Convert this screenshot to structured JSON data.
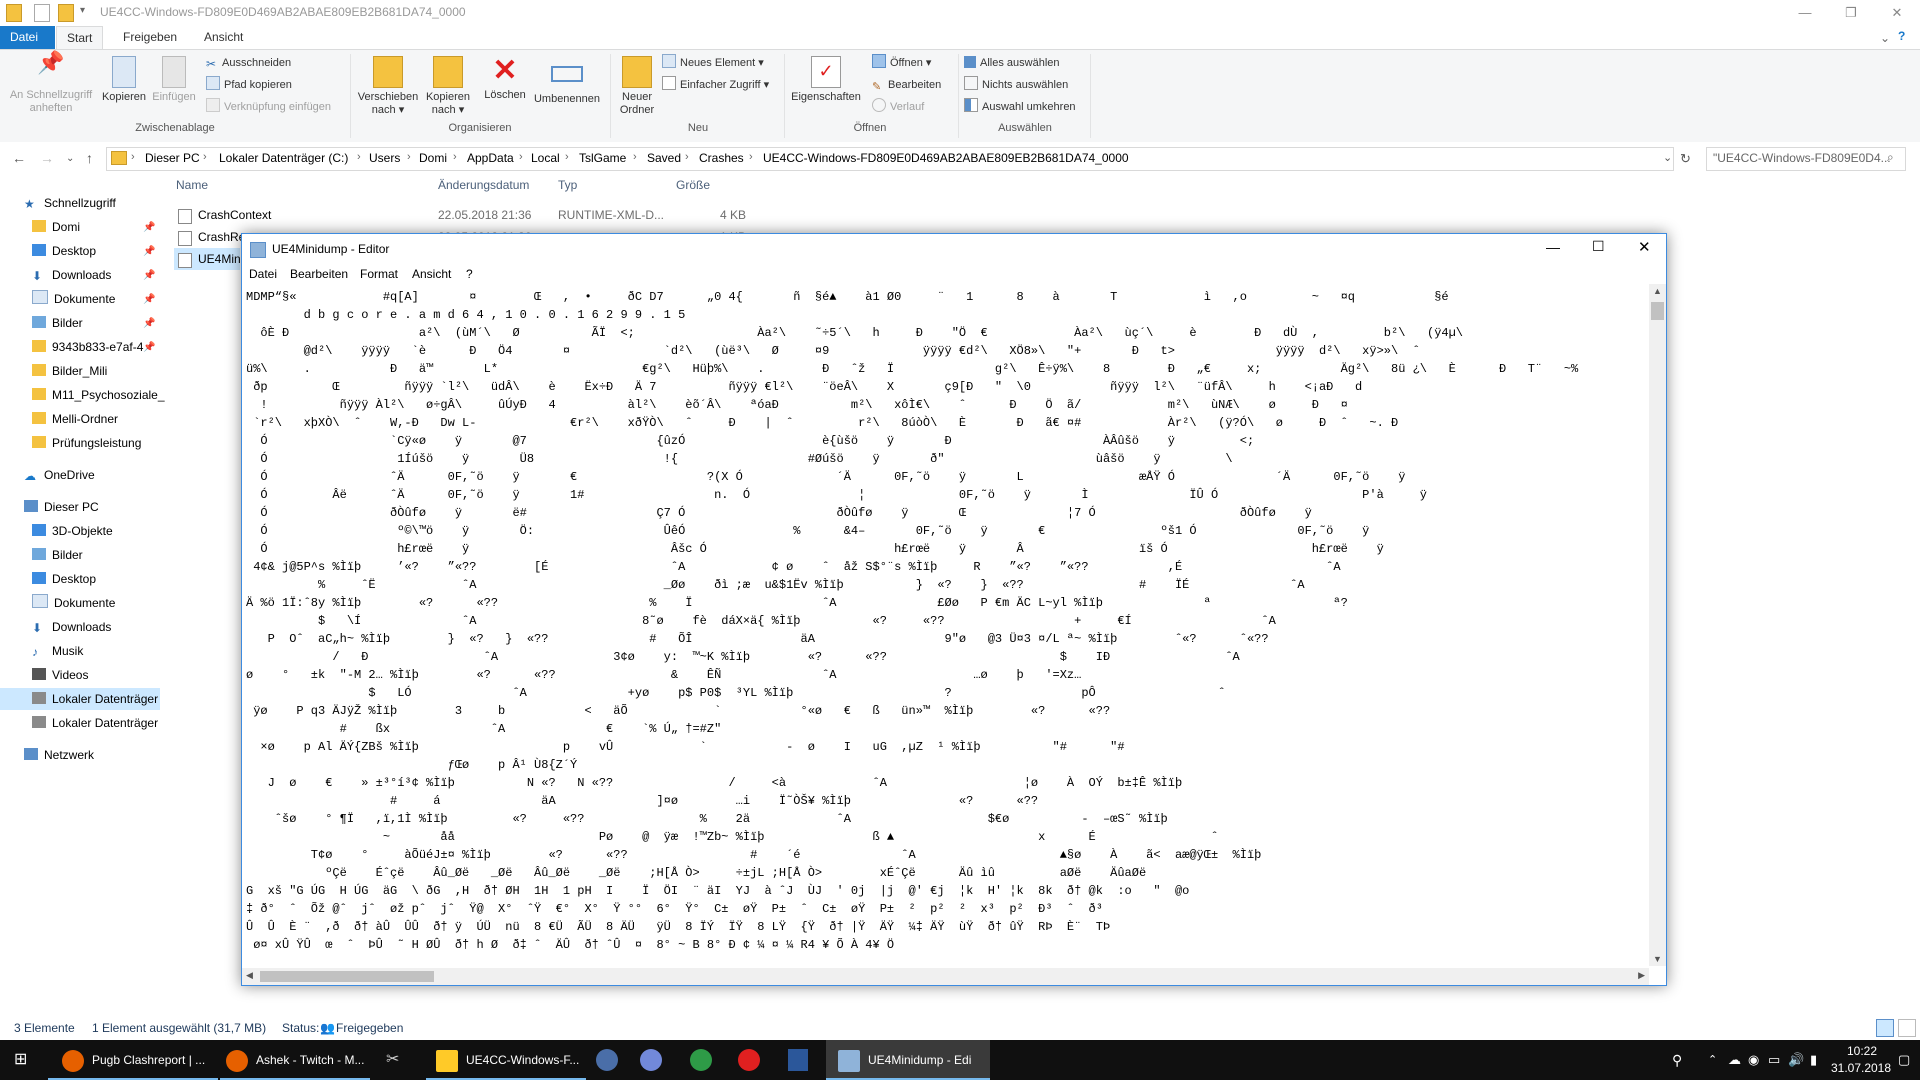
{
  "explorer": {
    "title": "UE4CC-Windows-FD809E0D469AB2ABAE809EB2B681DA74_0000",
    "tabs": [
      "Datei",
      "Start",
      "Freigeben",
      "Ansicht"
    ],
    "ribbon": {
      "clipboard": {
        "pin": "An Schnellzugriff anheften",
        "copy": "Kopieren",
        "paste": "Einfügen",
        "cut": "Ausschneiden",
        "copy_path": "Pfad kopieren",
        "paste_link": "Verknüpfung einfügen",
        "label": "Zwischenablage"
      },
      "organize": {
        "move": "Verschieben nach",
        "copy_to": "Kopieren nach",
        "delete": "Löschen",
        "rename": "Umbenennen",
        "label": "Organisieren"
      },
      "new": {
        "new_folder": "Neuer Ordner",
        "new_item": "Neues Element",
        "easy_access": "Einfacher Zugriff",
        "label": "Neu"
      },
      "open": {
        "properties": "Eigenschaften",
        "open": "Öffnen",
        "edit": "Bearbeiten",
        "history": "Verlauf",
        "label": "Öffnen"
      },
      "select": {
        "select_all": "Alles auswählen",
        "select_none": "Nichts auswählen",
        "invert": "Auswahl umkehren",
        "label": "Auswählen"
      }
    },
    "breadcrumb": [
      "Dieser PC",
      "Lokaler Datenträger (C:)",
      "Users",
      "Domi",
      "AppData",
      "Local",
      "TslGame",
      "Saved",
      "Crashes",
      "UE4CC-Windows-FD809E0D469AB2ABAE809EB2B681DA74_0000"
    ],
    "search_placeholder": "\"UE4CC-Windows-FD809E0D4...",
    "nav_pane": [
      {
        "label": "Schnellzugriff",
        "pinned": false
      },
      {
        "label": "Domi",
        "pinned": true
      },
      {
        "label": "Desktop",
        "pinned": true
      },
      {
        "label": "Downloads",
        "pinned": true
      },
      {
        "label": "Dokumente",
        "pinned": true
      },
      {
        "label": "Bilder",
        "pinned": true
      },
      {
        "label": "9343b833-e7af-4",
        "pinned": true
      },
      {
        "label": "Bilder_Mili",
        "pinned": false
      },
      {
        "label": "M11_Psychosoziale_",
        "pinned": false
      },
      {
        "label": "Melli-Ordner",
        "pinned": false
      },
      {
        "label": "Prüfungsleistung",
        "pinned": false
      },
      {
        "label": "OneDrive",
        "pinned": false
      },
      {
        "label": "Dieser PC",
        "pinned": false
      },
      {
        "label": "3D-Objekte",
        "pinned": false
      },
      {
        "label": "Bilder",
        "pinned": false
      },
      {
        "label": "Desktop",
        "pinned": false
      },
      {
        "label": "Dokumente",
        "pinned": false
      },
      {
        "label": "Downloads",
        "pinned": false
      },
      {
        "label": "Musik",
        "pinned": false
      },
      {
        "label": "Videos",
        "pinned": false
      },
      {
        "label": "Lokaler Datenträger",
        "pinned": false
      },
      {
        "label": "Lokaler Datenträger",
        "pinned": false
      },
      {
        "label": "Netzwerk",
        "pinned": false
      }
    ],
    "columns": [
      "Name",
      "Änderungsdatum",
      "Typ",
      "Größe"
    ],
    "files": [
      {
        "name": "CrashContext",
        "date": "22.05.2018 21:36",
        "type": "RUNTIME-XML-D...",
        "size": "4 KB"
      },
      {
        "name": "CrashRe",
        "date": "22.05.2018 21:36",
        "type": "",
        "size": "1 KB"
      },
      {
        "name": "UE4Mini",
        "date": "",
        "type": "",
        "size": ""
      }
    ],
    "status": {
      "count": "3 Elemente",
      "selected": "1 Element ausgewählt (31,7 MB)",
      "share": "Status:",
      "share_value": "Freigegeben"
    }
  },
  "notepad": {
    "title": "UE4Minidump - Editor",
    "menu": [
      "Datei",
      "Bearbeiten",
      "Format",
      "Ansicht",
      "?"
    ],
    "lines": [
      "MDMP“§«            #q[A]       ¤        Œ   ,  •     ðC D7      „0 4{       ñ  §é▲    à1 Ø0     ¨   1      8    à       T            ì   ,o         ~   ¤q           §é",
      "        d b g c o r e . a m d 6 4 , 1 0 . 0 . 1 6 2 9 9 . 1 5",
      "  ôÈ Ð                  a²\\  (ùM´\\   Ø          ÃÏ  <;                 Àa²\\    ˜÷5´\\   h     Ð    \"Ö  €            Àa²\\   ùç´\\     è        Ð   dÙ  ,         b²\\   (ÿ4µ\\",
      "        @d²\\    ÿÿÿÿ   `è      Ð   Ö4       ¤             `d²\\   (ùë³\\   Ø     ¤9             ÿÿÿÿ €d²\\   XÖ8»\\   \"+       Ð   t>              ÿÿÿÿ  d²\\   xÿ>»\\  ˆ",
      "ü%\\     .           Ð   ä™       L*                    €g²\\   Hüþ%\\    .        Ð   ˆž   Ï              g²\\   Ê÷ÿ%\\    8        Ð   „€     x;           Äg²\\   8ü ¿\\   È      Ð   T¨   ~%",
      " ðp         Œ         ñÿÿÿ `l²\\   üdÂ\\    è    Ëx÷Ð   Ä 7          ñÿÿÿ €l²\\    ¨öeÂ\\    X       ç9[Ð   \"  \\0           ñÿÿÿ  l²\\   ¨üfÂ\\     h    <¡aÐ   d",
      "  !          ñÿÿÿ Àl²\\   ø÷gÂ\\     ûÚyÐ   4          àl²\\    èõ´Â\\    ªóaÐ          m²\\   xôÌ€\\    ˆ      Ð    Ö  ã/            m²\\   ùNÆ\\    ø     Ð   ¤",
      " `r²\\   xþXÒ\\  ˆ    W,-Ð   Dw L-             €r²\\    xðŸÒ\\   ˆ     Ð    |  ˆ         r²\\   8úòÒ\\   È       Ð   ã€ ¤#            Àr²\\   (ÿ?Ó\\   ø     Ð  ˆ   ~. Ð",
      "  Ó                 `Cÿ«ø    ÿ       @7                  {ûzÓ                   è{ùšö    ÿ       Ð                     ÀÂûšö    ÿ         <;",
      "  Ó                  1Íúšö    ÿ       Ü8                  !{                  #Øúšö    ÿ       ð\"                     ùâšö    ÿ         \\",
      "  Ó                 ˆÄ      0F,˜ö    ÿ       €                  ?(X Ó             ´Ä      0F,˜ö    ÿ       L                æÅŸ Ó              ´Ä      0F,˜ö    ÿ",
      "  Ó         Âë      ˆÄ      0F,˜ö    ÿ       1#                  n.  Ó               ¦             0F,˜ö    ÿ       Ì              ÏÛ Ó                    P'à     ÿ",
      "  Ó                 ðÒûfø    ÿ       ë#                  Ç7 Ó                     ðÒûfø    ÿ       Œ              ¦7 Ó                    ðÒûfø    ÿ",
      "  Ó                  º©\\™ö    ÿ       Ö:                  ÛêÓ               %      &4–       0F,˜ö    ÿ       €                ºš1 Ó              0F,˜ö    ÿ",
      "  Ó                  h£rœë    ÿ                            Âšc Ó                          h£rœë    ÿ       Â                ïš Ó                    h£rœë    ÿ",
      " 4¢& j@5P^s %Ìïþ     ’«?    ”«??        [É                 ˆA            ¢ ø    ˆ  åž S$°¨s %Ìïþ     R    ”«?    ”«??           ,É                    ˆA",
      "          %     ˆË            ˆA                          _Øø    ðì ;æ  u&$1Ëv %Ìïþ          }  «?    }  «??                #    ÏÉ              ˆA",
      "Ä %ö 1Ï:ˆ8y %Ìïþ        «?      «??                     %    Ï                  ˆA              £Øø   P €m ÄC L~yl %Ìïþ              ª                 ª?",
      "          $   \\Í              ˆA                       8˜ø    fè  dáX×ä{ %Ìïþ          «?     «??                  +     €Í                  ˆA",
      "   P  Oˆ  aC„h~ %Ìïþ        }  «?   }  «??              #   ÕÎ               äA                  9\"ø   @3 Ü¤3 ¤/L ª~ %Ìïþ        ˆ«?      ˆ«??",
      "            /   Ð                ˆA                3¢ø    y:  ™~K %Ìïþ        «?      «??                        $    IÐ                ˆA",
      "ø    °   ±k  \"-M 2… %Ìïþ        «?      «??                &    ÊÑ              ˆA                   …ø    þ   '=Xz…",
      "                 $   LÓ              ˆA              +yø    p$ P0$  ³YL %Ìïþ                     ?                  pÔ                 ˆ",
      " ÿø    P q3 ÄJÿŽ %Ìïþ        3     b           <   äÕ            `           °«ø   €   ß   ün»™  %Ìïþ        «?      «??",
      "             #    ßx              ˆA              €    `% Ú„ †=#Z\"",
      "  ×ø    p Al ÄÝ{ZBš %Ìïþ                    p    vÛ            `           -  ø    I   uG  ,µZ  ¹ %Ìïþ          \"#      \"#",
      "                            ƒŒø    p Â¹ Ù8{Z´Ý",
      "   J  ø    €    » ±³°í³¢ %Ìïþ          N «?   N «??                /     <à            ˆA                   ¦ø    À  OÝ  b±‡Ê %Ìïþ",
      "                    #     á              äA              ]¤ø        …i    Ï˜ÒŠ¥ %Ìïþ               «?      «??",
      "    ˆšø    ° ¶Ï   ,ï,1Ì %Ìïþ         «?     «??                %    2ä            ˆA                   $€ø          -  –œS˜ %Ìïþ",
      "                   ~       åå                    Pø    @  ÿæ  !™Zb~ %Ìïþ               ß ▲                    x      É                ˆ",
      "         T¢ø    °     àÕüéJ±¤ %Ìïþ        «?      «??                 #    ´é              ˆA                    ▲§ø    À    ã<  aæ@ÿŒ±  %Ìïþ",
      "           ºÇë    Éˆçë    Âû_Øë   _Øë   Âû_Øë    _Øë    ;H[Å Ò>     ÷±jL ;H[Å Ò>        xÉˆÇë      Äû ìû         aØë    ÄûaØë",
      "G  xš \"G ÚG  H ÚG  äG  \\ ðG  ,H  ð† ØH  1H  1 pH  I    Ï  ÖI  ¨ äI  YJ  à ˆJ  ÙJ  ' 0j  |j  @' €j  ¦k  H' ¦k  8k  ð† @k  :o   \"  @o",
      "‡ ð°  ˆ  Õž @ˆ  jˆ  øž pˆ  jˆ  Ÿ@  X°  ˆŸ  €°  X°  Ÿ °°  6°  Ÿ°  C±  øŸ  P±  ˆ  C±  øŸ  P±  ²  p²  ²  x³  p²  Ð³  ˆ  ð³",
      "Û  Û  È ¨  ,ð  ð† àÛ  ÛÛ  ð† ÿ  ÚÜ  nü  8 €Ü  ÃÜ  8 ÄÜ   ÿÜ  8 ÏÝ  ÏŸ  8 LŸ  {Ÿ  ð† |Ÿ  ÄŸ  ¼‡ ÄŸ  ùŸ  ð† ûŸ  RÞ  È¨  TÞ",
      " ø¤ xÛ ŸÛ  œ  ˆ  ÞÛ  ˜ H ØÛ  ð† h Ø  ð‡ ˆ  ÄÛ  ð† ˆÛ  ¤  8° ~ B 8° Ð ¢ ¼ ¤ ¼ R4 ¥ Õ À 4¥ Ö"
    ]
  },
  "taskbar": {
    "items": [
      {
        "label": "Pugb Clashreport | ...",
        "color": "#e66000"
      },
      {
        "label": "Ashek - Twitch - M...",
        "color": "#e66000"
      },
      {
        "label": "UE4CC-Windows-F...",
        "color": "#ffca28"
      },
      {
        "label": "UE4Minidump - Edi",
        "color": "#8fb3d9"
      }
    ],
    "time": "10:22",
    "date": "31.07.2018"
  }
}
